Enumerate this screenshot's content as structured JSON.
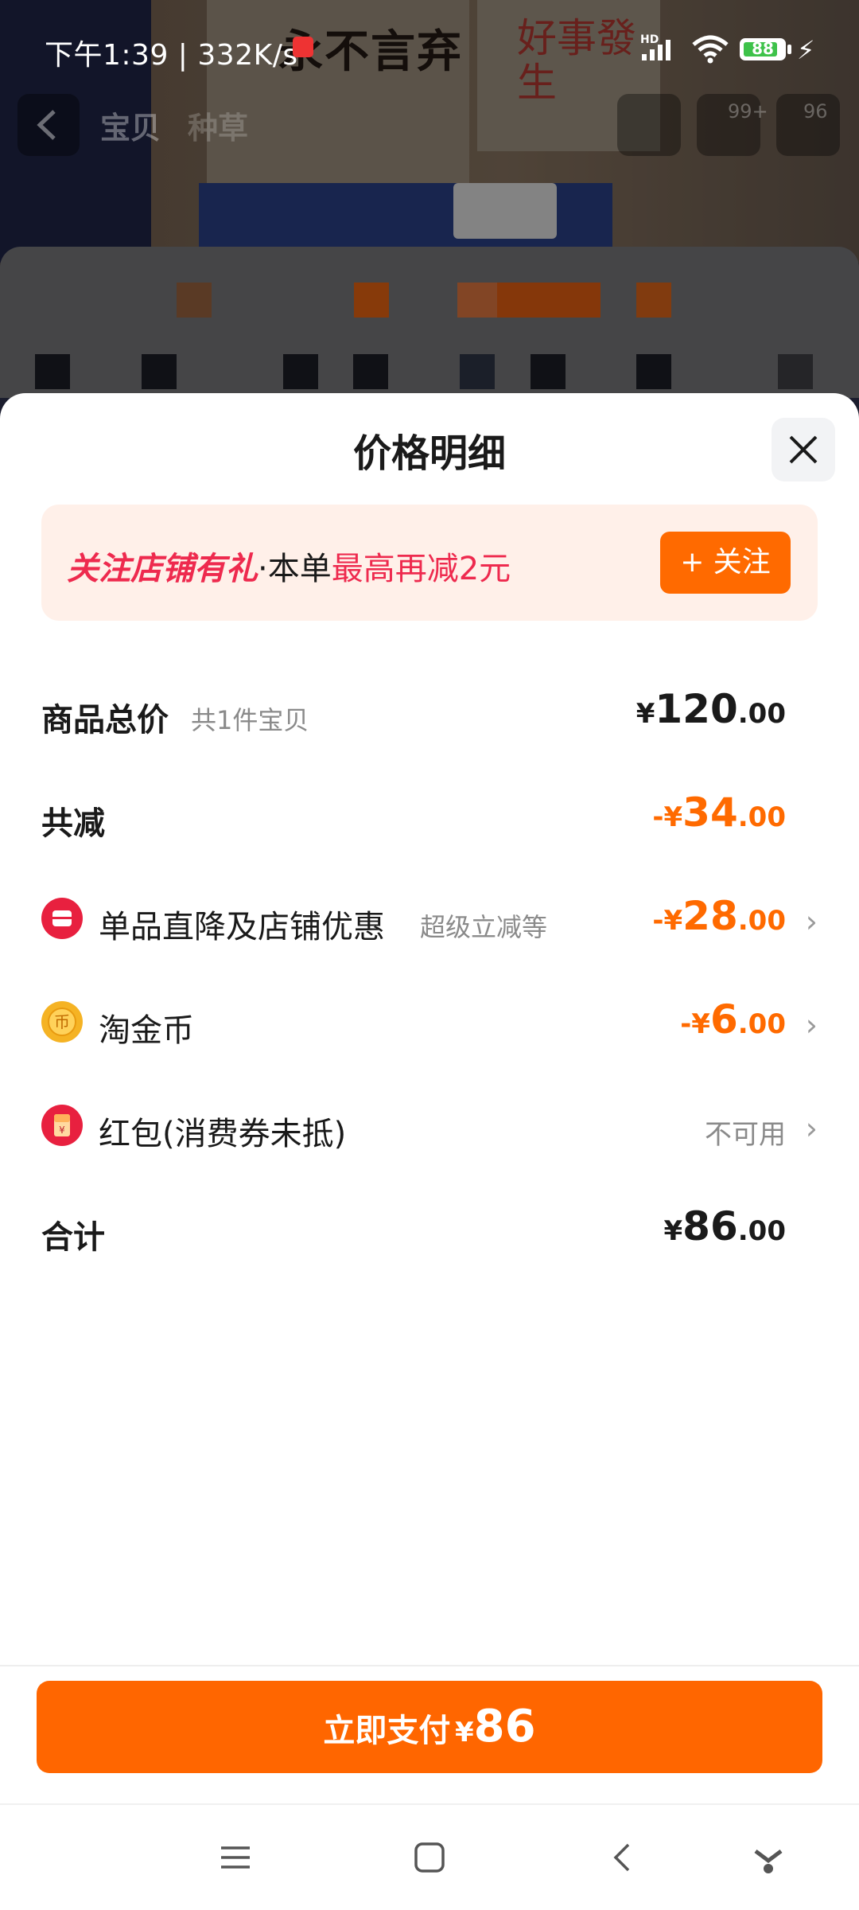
{
  "status_bar": {
    "time": "下午1:39",
    "separator": "|",
    "net_speed": "332K/s",
    "battery_level": "88",
    "signal_label": "HD"
  },
  "background_page": {
    "nav_tabs": [
      "宝贝",
      "种草"
    ],
    "cart_badge": "99+",
    "more_badge": "96",
    "poster_text_1": "永不言弃",
    "poster_text_2": "好事發生"
  },
  "sheet": {
    "title": "价格明细",
    "promo": {
      "highlight": "关注店铺有礼",
      "middle": "·本单",
      "tail": "最高再减2元",
      "follow_button": "+ 关注"
    },
    "rows": {
      "subtotal": {
        "label": "商品总价",
        "sub": "共1件宝贝",
        "currency": "¥",
        "int": "120",
        "dec": ".00"
      },
      "total_reduction": {
        "label": "共减",
        "currency": "-¥",
        "int": "34",
        "dec": ".00"
      },
      "shop_discount": {
        "label": "单品直降及店铺优惠",
        "sub": "超级立减等",
        "currency": "-¥",
        "int": "28",
        "dec": ".00",
        "icon": "shop-discount-icon"
      },
      "taojin_coin": {
        "label": "淘金币",
        "currency": "-¥",
        "int": "6",
        "dec": ".00",
        "icon": "coin-icon"
      },
      "red_packet": {
        "label": "红包(消费券未抵)",
        "status": "不可用",
        "icon": "red-packet-icon"
      },
      "total": {
        "label": "合计",
        "currency": "¥",
        "int": "86",
        "dec": ".00"
      }
    },
    "pay_button": {
      "label": "立即支付",
      "currency": "¥",
      "amount": "86"
    }
  },
  "colors": {
    "accent": "#ff6a00",
    "promo_red": "#ee2a4e",
    "promo_bg": "#fff0e9"
  }
}
